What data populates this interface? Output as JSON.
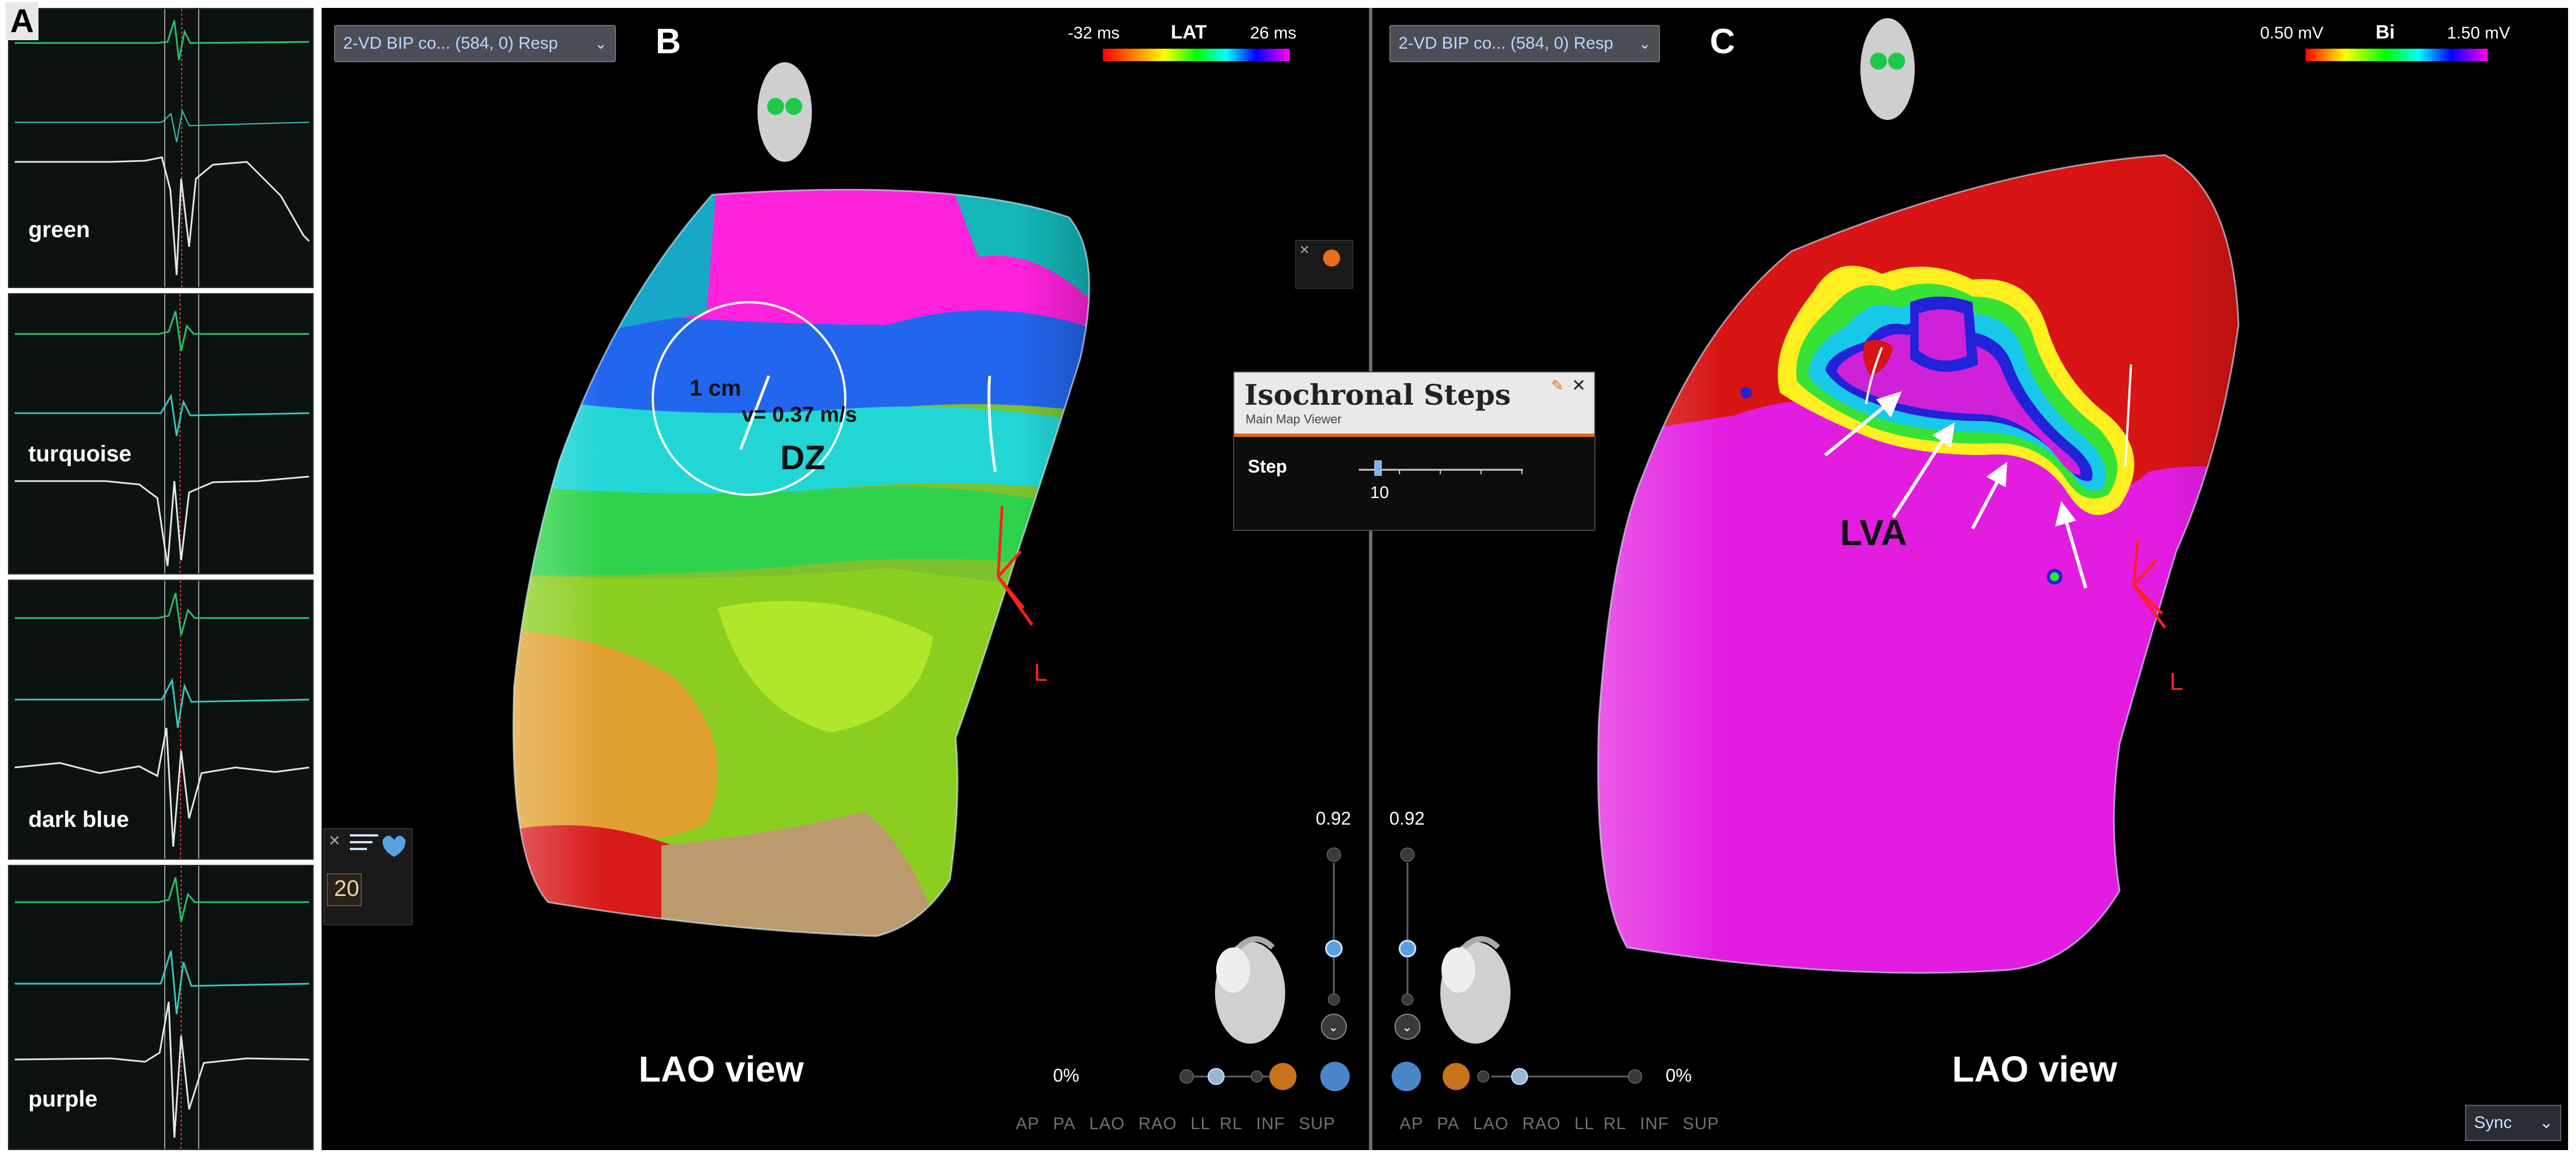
{
  "panel_a": {
    "letter": "A",
    "traces": [
      {
        "label": "green"
      },
      {
        "label": "turquoise"
      },
      {
        "label": "dark blue"
      },
      {
        "label": "purple"
      }
    ]
  },
  "panel_b": {
    "letter": "B",
    "dropdown": "2-VD BIP co... (584, 0) Resp",
    "colorbar": {
      "min": "-32 ms",
      "title": "LAT",
      "max": "26 ms"
    },
    "annotations": {
      "distance": "1 cm",
      "velocity": "v= 0.37 m/s",
      "zone": "DZ",
      "marker": "L"
    },
    "view_label": "LAO view",
    "frame_count": "20",
    "transparency": "0.92",
    "opacity": "0%",
    "orientation_buttons": [
      "AP",
      "PA",
      "LAO",
      "RAO",
      "LL",
      "RL",
      "INF",
      "SUP"
    ]
  },
  "isochronal_steps": {
    "title": "Isochronal Steps",
    "subtitle": "Main Map Viewer",
    "step_label": "Step",
    "step_value": "10"
  },
  "panel_c": {
    "letter": "C",
    "dropdown": "2-VD BIP co... (584, 0) Resp",
    "colorbar": {
      "min": "0.50 mV",
      "title": "Bi",
      "max": "1.50 mV"
    },
    "annotations": {
      "region": "LVA",
      "marker": "L"
    },
    "view_label": "LAO view",
    "transparency": "0.92",
    "opacity": "0%",
    "orientation_buttons": [
      "AP",
      "PA",
      "LAO",
      "RAO",
      "LL",
      "RL",
      "INF",
      "SUP"
    ],
    "sync": "Sync"
  },
  "colors": {
    "lat_scale": [
      "#ff0000",
      "#ff8800",
      "#ffff00",
      "#00ff00",
      "#00ffff",
      "#0000ff",
      "#ff00ff"
    ],
    "voltage_scale": [
      "#ff0000",
      "#ffff00",
      "#00ff00",
      "#00ffff",
      "#0000ff",
      "#ff00ff"
    ]
  }
}
